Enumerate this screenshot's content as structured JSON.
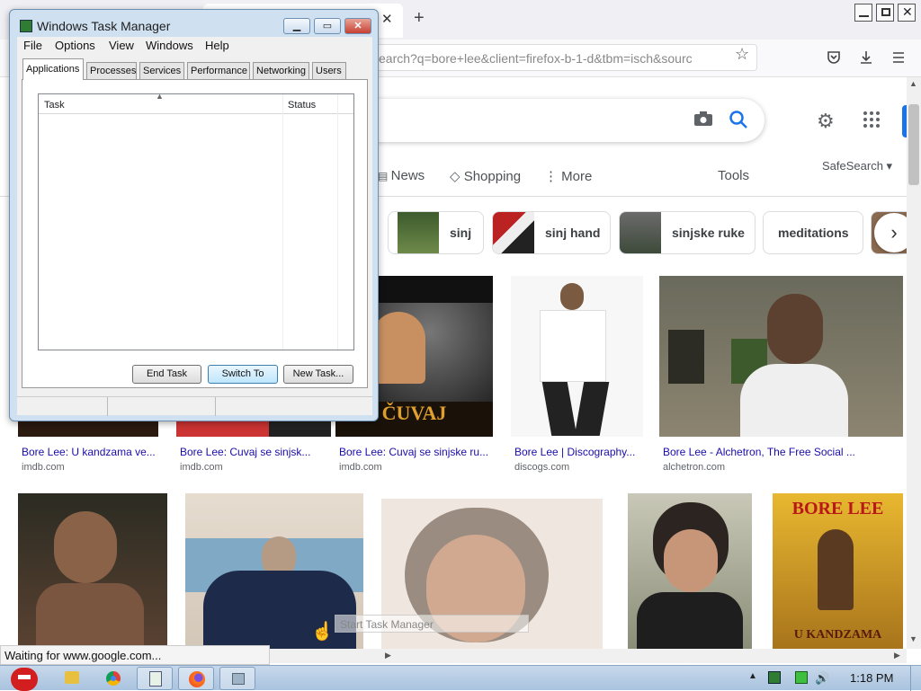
{
  "browser": {
    "url": "earch?q=bore+lee&client=firefox-b-1-d&tbm=isch&sourc",
    "tab_close": "✕",
    "new_tab": "+",
    "status_text": "Waiting for www.google.com..."
  },
  "google": {
    "tabs": [
      {
        "label": "News",
        "icon": "news-icon"
      },
      {
        "label": "Shopping",
        "icon": "tag-icon"
      },
      {
        "label": "More",
        "icon": "kebab-icon"
      }
    ],
    "tools": "Tools",
    "safesearch": "SafeSearch ▾",
    "chips": [
      {
        "label": "sinj"
      },
      {
        "label": "sinj hand"
      },
      {
        "label": "sinjske ruke"
      },
      {
        "label": "meditations"
      }
    ],
    "results_row1": [
      {
        "title": "Bore Lee: U kandzama ve...",
        "source": "imdb.com"
      },
      {
        "title": "Bore Lee: Cuvaj se sinjsk...",
        "source": "imdb.com"
      },
      {
        "title": "Bore Lee: Cuvaj se sinjske ru...",
        "source": "imdb.com"
      },
      {
        "title": "Bore Lee | Discography...",
        "source": "discogs.com"
      },
      {
        "title": "Bore Lee - Alchetron, The Free Social ...",
        "source": "alchetron.com"
      }
    ],
    "poster_text": "BORE LEE",
    "poster_bottom": "U KANDZAMA"
  },
  "task_manager": {
    "title": "Windows Task Manager",
    "menu": [
      "File",
      "Options",
      "View",
      "Windows",
      "Help"
    ],
    "tabs": [
      "Applications",
      "Processes",
      "Services",
      "Performance",
      "Networking",
      "Users"
    ],
    "columns": {
      "task": "Task",
      "status": "Status"
    },
    "buttons": {
      "end_task": "End Task",
      "switch_to": "Switch To",
      "new_task": "New Task..."
    }
  },
  "tooltip": "Start Task Manager",
  "taskbar": {
    "clock": "1:18 PM"
  },
  "colors": {
    "accent": "#1a73e8",
    "link": "#1a0dab"
  }
}
